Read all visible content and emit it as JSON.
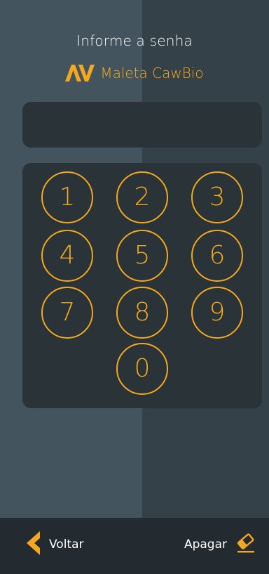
{
  "header": {
    "title": "Informe a senha",
    "brand_name": "Maleta CawBio",
    "brand_icon": "cawbio-logo-icon"
  },
  "keypad": {
    "keys": [
      "1",
      "2",
      "3",
      "4",
      "5",
      "6",
      "7",
      "8",
      "9",
      "0"
    ]
  },
  "footer": {
    "back_label": "Voltar",
    "back_icon": "chevron-left-icon",
    "erase_label": "Apagar",
    "erase_icon": "eraser-icon"
  },
  "colors": {
    "accent": "#f4a81f",
    "background_left": "#43545f",
    "background_right": "#354148",
    "panel": "#2a3338",
    "bottom_bar": "#242b30",
    "text": "#ffffff"
  }
}
